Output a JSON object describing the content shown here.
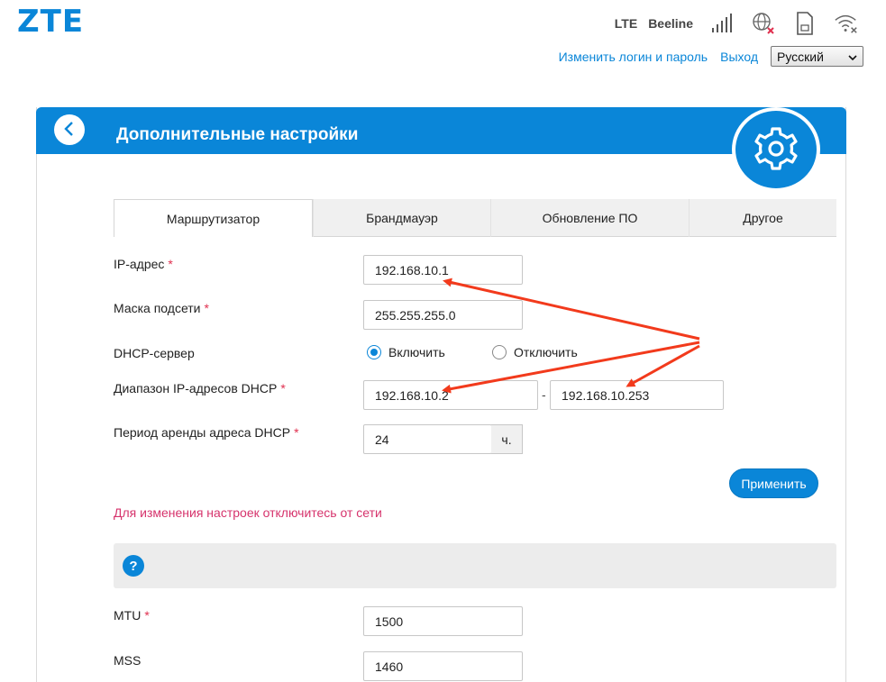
{
  "header": {
    "logo": "ZTE",
    "network_type": "LTE",
    "operator": "Beeline",
    "links": {
      "change_login": "Изменить логин и пароль",
      "logout": "Выход"
    },
    "language": "Русский",
    "icons": [
      "signal-bars-icon",
      "globe-disconnected-icon",
      "sim-card-icon",
      "wifi-disabled-icon"
    ]
  },
  "panel": {
    "title": "Дополнительные настройки"
  },
  "tabs": [
    {
      "label": "Маршрутизатор",
      "active": true
    },
    {
      "label": "Брандмауэр",
      "active": false
    },
    {
      "label": "Обновление ПО",
      "active": false
    },
    {
      "label": "Другое",
      "active": false
    }
  ],
  "form": {
    "ip": {
      "label": "IP-адрес",
      "required": "*",
      "value": "192.168.10.1"
    },
    "mask": {
      "label": "Маска подсети",
      "required": "*",
      "value": "255.255.255.0"
    },
    "dhcp": {
      "label": "DHCP-сервер",
      "enable": "Включить",
      "disable": "Отключить",
      "selected": "enable"
    },
    "range": {
      "label": "Диапазон IP-адресов DHCP",
      "required": "*",
      "start": "192.168.10.2",
      "separator": "-",
      "end": "192.168.10.253"
    },
    "lease": {
      "label": "Период аренды адреса DHCP",
      "required": "*",
      "value": "24",
      "unit": "ч."
    },
    "apply": "Применить",
    "warning": "Для изменения настроек отключитесь от сети"
  },
  "help": {
    "icon_text": "?"
  },
  "form2": {
    "mtu": {
      "label": "MTU",
      "required": "*",
      "value": "1500"
    },
    "mss": {
      "label": "MSS",
      "value": "1460"
    }
  },
  "colors": {
    "accent": "#0a86d8",
    "warning": "#d6336c",
    "annotation_arrow": "#f23a1c"
  }
}
